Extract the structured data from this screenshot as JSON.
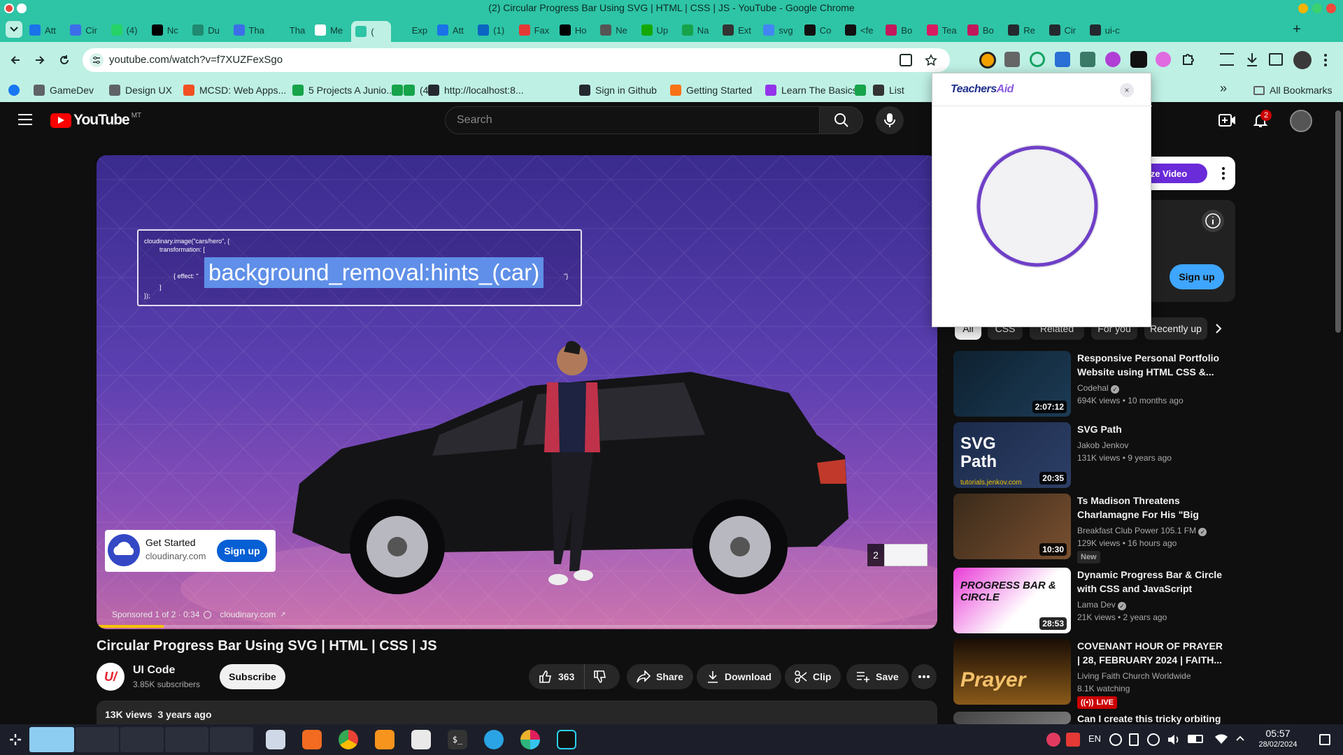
{
  "window": {
    "title": "(2) Circular Progress Bar Using SVG | HTML | CSS | JS - YouTube - Google Chrome"
  },
  "tabs": [
    {
      "label": "Att",
      "color": "#1a73e8"
    },
    {
      "label": "Cir",
      "color": "#3b6ee8"
    },
    {
      "label": "(4)",
      "color": "#25d366"
    },
    {
      "label": "Nc",
      "color": "#000000"
    },
    {
      "label": "Du",
      "color": "#1f8a70"
    },
    {
      "label": "Tha",
      "color": "#3b6ee8"
    },
    {
      "label": "Tha",
      "color": "#2ec4a6"
    },
    {
      "label": "Me",
      "color": "#ffffff"
    },
    {
      "label": "(",
      "color": "#2ec4a6"
    },
    {
      "label": "Exp",
      "color": "#2ec4a6"
    },
    {
      "label": "Att",
      "color": "#1a73e8"
    },
    {
      "label": "(1)",
      "color": "#0a66c2"
    },
    {
      "label": "Fax",
      "color": "#e53935"
    },
    {
      "label": "Ho",
      "color": "#000000"
    },
    {
      "label": "Ne",
      "color": "#555555"
    },
    {
      "label": "Up",
      "color": "#14a800"
    },
    {
      "label": "Na",
      "color": "#16a34a"
    },
    {
      "label": "Ext",
      "color": "#333333"
    },
    {
      "label": "svg",
      "color": "#4285f4"
    },
    {
      "label": "Co",
      "color": "#111111"
    },
    {
      "label": "<fe",
      "color": "#111111"
    },
    {
      "label": "Bo",
      "color": "#c2185b"
    },
    {
      "label": "Tea",
      "color": "#d81b60"
    },
    {
      "label": "Bo",
      "color": "#c2185b"
    },
    {
      "label": "Re",
      "color": "#24292f"
    },
    {
      "label": "Cir",
      "color": "#24292f"
    },
    {
      "label": "ui-c",
      "color": "#24292f"
    }
  ],
  "address": {
    "url": "youtube.com/watch?v=f7XUZFexSgo"
  },
  "bookmarks": [
    {
      "label": "GameDev",
      "color": "#5f6368"
    },
    {
      "label": "Design UX",
      "color": "#5f6368"
    },
    {
      "label": "MCSD: Web Apps...",
      "color": "#f25022"
    },
    {
      "label": "5 Projects A Junio...",
      "color": "#16a34a"
    },
    {
      "label": "(4)",
      "color": "#16a34a"
    },
    {
      "label": "http://localhost:8...",
      "color": "#24292f"
    },
    {
      "label": "Sign in Github",
      "color": "#24292f"
    },
    {
      "label": "Getting Started",
      "color": "#f97316"
    },
    {
      "label": "Learn The Basics...",
      "color": "#9333ea"
    },
    {
      "label": "List",
      "color": "#333333"
    }
  ],
  "bookmarks_extra": {
    "all_bookmarks": "All Bookmarks",
    "overflow": "»"
  },
  "youtube": {
    "logo_text": "YouTube",
    "region": "MT",
    "search_placeholder": "Search",
    "notifications_count": "2"
  },
  "player": {
    "code_line1": "cloudinary.image(\"cars/hero\", {",
    "code_line2": "transformation: [",
    "code_line3": "{ effect: \"",
    "code_highlight": "background_removal:hints_(car)",
    "code_line3_end": "\"}",
    "code_line4": "]",
    "code_line5": "});",
    "ad_title": "Get Started",
    "ad_domain": "cloudinary.com",
    "ad_signup": "Sign up",
    "ad_badge": "2",
    "sponsored": "Sponsored 1 of 2 · 0:34",
    "sponsor_link": "cloudinary.com",
    "progress": 0.08
  },
  "video": {
    "title": "Circular Progress Bar Using SVG | HTML | CSS | JS",
    "channel": "UI Code",
    "subscribers": "3.85K subscribers",
    "subscribe": "Subscribe",
    "likes": "363",
    "share": "Share",
    "download": "Download",
    "clip": "Clip",
    "save": "Save",
    "views_line": "13K views  3 years ago"
  },
  "popup": {
    "title_part1": "Teachers",
    "title_part2": "Aid",
    "accent": "#6f3fc8"
  },
  "side_ad": {
    "button": "arize Video",
    "signup": "Sign up"
  },
  "chips": [
    {
      "label": "All"
    },
    {
      "label": "CSS"
    },
    {
      "label": "Related"
    },
    {
      "label": "For you"
    },
    {
      "label": "Recently up"
    }
  ],
  "recommendations": [
    {
      "title": "Responsive Personal Portfolio Website using HTML CSS &...",
      "channel": "Codehal",
      "verified": true,
      "meta": "694K views • 10 months ago",
      "duration": "2:07:12",
      "badge": ""
    },
    {
      "title": "SVG Path",
      "channel": "Jakob Jenkov",
      "verified": false,
      "meta": "131K views • 9 years ago",
      "duration": "20:35",
      "badge": "",
      "thumb_text": "SVG Path",
      "thumb_caption": "tutorials.jenkov.com"
    },
    {
      "title": "Ts Madison Threatens Charlamagne For His \"Big Bac...",
      "channel": "Breakfast Club Power 105.1 FM",
      "verified": true,
      "meta": "129K views • 16 hours ago",
      "duration": "10:30",
      "badge": "New"
    },
    {
      "title": "Dynamic Progress Bar & Circle with CSS and JavaScript",
      "channel": "Lama Dev",
      "verified": true,
      "meta": "21K views • 2 years ago",
      "duration": "28:53",
      "badge": "",
      "thumb_text": "PROGRESS BAR & CIRCLE"
    },
    {
      "title": "COVENANT HOUR OF PRAYER | 28, FEBRUARY 2024 | FAITH...",
      "channel": "Living Faith Church Worldwide",
      "verified": false,
      "meta": "8.1K watching",
      "duration": "",
      "badge": "LIVE",
      "thumb_text": "Prayer"
    },
    {
      "title": "Can I create this tricky orbiting",
      "channel": "",
      "verified": false,
      "meta": "",
      "duration": "",
      "badge": ""
    }
  ],
  "taskbar": {
    "lang": "EN",
    "time": "05:57",
    "date": "28/02/2024"
  }
}
